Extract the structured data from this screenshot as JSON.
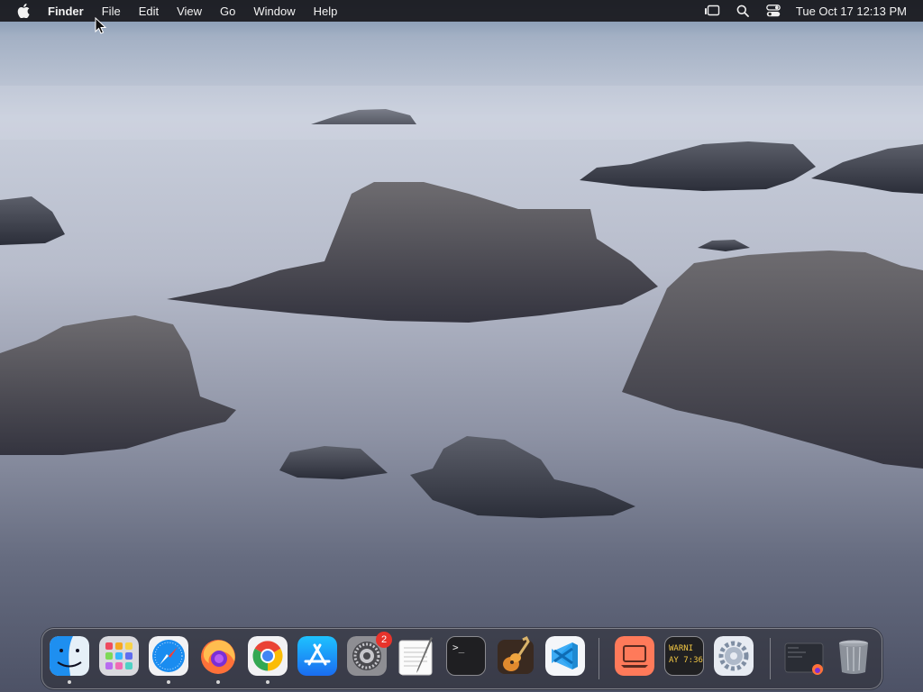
{
  "menubar": {
    "app_name": "Finder",
    "menus": [
      "File",
      "Edit",
      "View",
      "Go",
      "Window",
      "Help"
    ],
    "clock": "Tue Oct 17  12:13 PM"
  },
  "dock": {
    "items": [
      {
        "name": "Finder",
        "running": true
      },
      {
        "name": "Launchpad",
        "running": false
      },
      {
        "name": "Safari",
        "running": true
      },
      {
        "name": "Firefox",
        "running": true
      },
      {
        "name": "Google Chrome",
        "running": true
      },
      {
        "name": "App Store",
        "running": false
      },
      {
        "name": "System Settings",
        "running": false,
        "badge": "2"
      },
      {
        "name": "TextEdit",
        "running": false
      },
      {
        "name": "Terminal",
        "running": false
      },
      {
        "name": "GarageBand",
        "running": false
      },
      {
        "name": "Visual Studio Code",
        "running": false
      },
      {
        "name": "Screen Sharing",
        "running": false
      },
      {
        "name": "Console",
        "running": false
      },
      {
        "name": "System Preferences",
        "running": false
      },
      {
        "name": "Downloads",
        "running": false
      },
      {
        "name": "Trash",
        "running": false
      }
    ],
    "terminal_prompt": ">_",
    "console_line1": "WARNI",
    "console_line2": "AY 7:36"
  }
}
